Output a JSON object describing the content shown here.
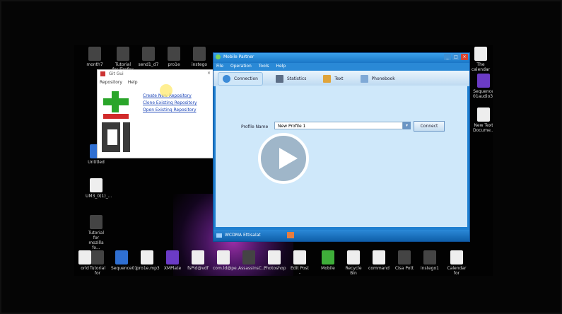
{
  "desktop": {
    "top_icons": [
      "month7",
      "Tutorial for Firefox",
      "send1_d7",
      "pro1e",
      "instego"
    ],
    "top_right_icon": "The calendar",
    "right_icons": [
      "Sequence 01audio3d...",
      "New Text Docume..."
    ],
    "left_icons": [
      "Untitled",
      "UM3_0(1)_...",
      "Tutorial for mozilla fo..."
    ],
    "bottom_icons": [
      "orld",
      "Tutorial for",
      "Sequence01",
      "pro1e.mp3",
      "XMPlate",
      "fsPid@vdf",
      "com.ld@pe..",
      "AssassinsC...",
      "Photoshop",
      "Edit Post -",
      "Mobile",
      "Recycle Bin",
      "command",
      "Cisa Pott",
      "instego1",
      "Calendar for"
    ]
  },
  "git_window": {
    "title": "Git Gui",
    "menu": [
      "Repository",
      "Help"
    ],
    "links": [
      "Create New Repository",
      "Clone Existing Repository",
      "Open Existing Repository"
    ]
  },
  "mobile_partner": {
    "title": "Mobile Partner",
    "menu": [
      "File",
      "Operation",
      "Tools",
      "Help"
    ],
    "tabs": [
      "Connection",
      "Statistics",
      "Text",
      "Phonebook"
    ],
    "profile_label": "Profile Name",
    "profile_value": "New Profile 1",
    "connect_label": "Connect",
    "status_signal": "WCDMA",
    "status_text": "Ettisalat"
  },
  "colors": {
    "window_blue": "#1f7fd0",
    "content_bg": "#cfe8fa",
    "play_circle": "#ffffff"
  }
}
